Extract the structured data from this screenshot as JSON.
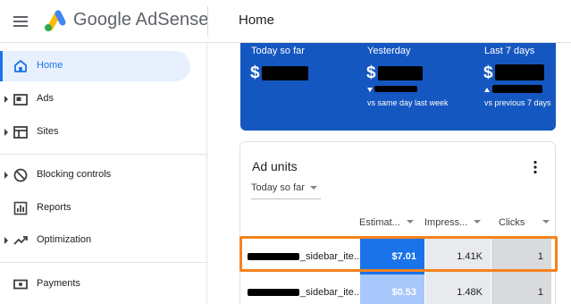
{
  "header": {
    "brand": "Google AdSense",
    "page_title": "Home"
  },
  "sidebar": {
    "items": [
      {
        "label": "Home",
        "icon": "home-icon",
        "active": true
      },
      {
        "label": "Ads",
        "icon": "ads-icon",
        "expandable": true
      },
      {
        "label": "Sites",
        "icon": "sites-icon",
        "expandable": true
      },
      {
        "label": "Blocking controls",
        "icon": "block-icon",
        "expandable": true
      },
      {
        "label": "Reports",
        "icon": "reports-icon"
      },
      {
        "label": "Optimization",
        "icon": "trending-up-icon",
        "expandable": true
      },
      {
        "label": "Payments",
        "icon": "payments-icon"
      }
    ]
  },
  "summary": {
    "today": {
      "label": "Today so far",
      "currency": "$"
    },
    "yesterday": {
      "label": "Yesterday",
      "currency": "$",
      "trend": "down",
      "comparison": "vs same day last week"
    },
    "last7": {
      "label": "Last 7 days",
      "currency": "$",
      "trend": "up",
      "comparison": "vs previous 7 days"
    }
  },
  "ad_units": {
    "title": "Ad units",
    "range": "Today so far",
    "columns": [
      "Estimat...",
      "Impress...",
      "Clicks"
    ],
    "rows": [
      {
        "name_suffix": "_sidebar_ite...",
        "estimated": "$7.01",
        "impressions": "1.41K",
        "clicks": "1",
        "highlighted": true
      },
      {
        "name_suffix": "_sidebar_ite...",
        "estimated": "$0.53",
        "impressions": "1.48K",
        "clicks": "1"
      }
    ]
  },
  "colors": {
    "accent": "#1a73e8",
    "summary_bg": "#1557c0",
    "highlight_outline": "#f5821f",
    "estimated_strong": "#1a73e8",
    "estimated_weak": "#a8c7fa"
  }
}
